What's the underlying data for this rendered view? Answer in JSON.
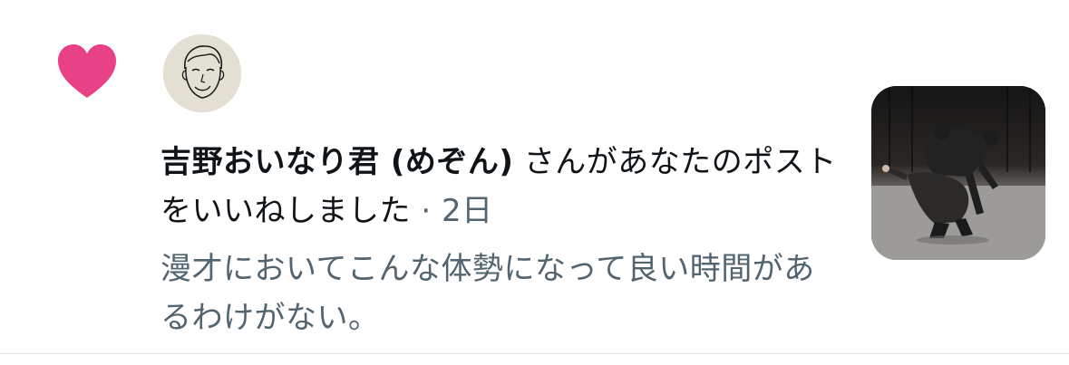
{
  "notification": {
    "type": "like",
    "heart_color": "#e94187",
    "avatar_icon": "hand-drawn-face-avatar",
    "user_name": "吉野おいなり君 (めぞん)",
    "action_text": "さんがあなたのポストをいいねしました",
    "separator": "·",
    "time_ago": "2日",
    "post_text": "漫才においてこんな体勢になって良い時間があるわけがない。",
    "thumbnail_icon": "stage-performance-photo"
  },
  "colors": {
    "primary_text": "#0f1419",
    "secondary_text": "#536471",
    "divider": "#e1e6ea"
  }
}
